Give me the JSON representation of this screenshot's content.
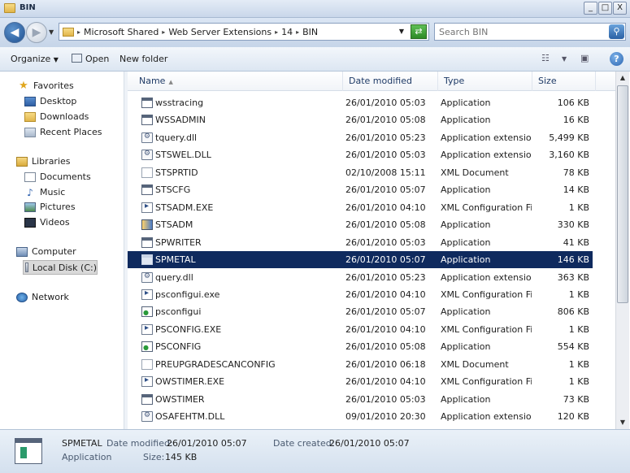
{
  "window": {
    "title": "BIN",
    "controls": [
      "_",
      "□",
      "X"
    ]
  },
  "address": {
    "crumbs": [
      "Microsoft Shared",
      "Web Server Extensions",
      "14",
      "BIN"
    ],
    "search_placeholder": "Search BIN"
  },
  "toolbar": {
    "organize": "Organize",
    "open": "Open",
    "new_folder": "New folder"
  },
  "nav": {
    "favorites": "Favorites",
    "desktop": "Desktop",
    "downloads": "Downloads",
    "recent": "Recent Places",
    "libraries": "Libraries",
    "documents": "Documents",
    "music": "Music",
    "pictures": "Pictures",
    "videos": "Videos",
    "computer": "Computer",
    "local_disk": "Local Disk (C:)",
    "network": "Network"
  },
  "columns": {
    "name": "Name",
    "date": "Date modified",
    "type": "Type",
    "size": "Size"
  },
  "files": [
    {
      "name": "wsstracing",
      "date": "26/01/2010 05:03",
      "type": "Application",
      "size": "106 KB",
      "icon": "app"
    },
    {
      "name": "WSSADMIN",
      "date": "26/01/2010 05:08",
      "type": "Application",
      "size": "16 KB",
      "icon": "app"
    },
    {
      "name": "tquery.dll",
      "date": "26/01/2010 05:23",
      "type": "Application extension",
      "size": "5,499 KB",
      "icon": "dll"
    },
    {
      "name": "STSWEL.DLL",
      "date": "26/01/2010 05:03",
      "type": "Application extension",
      "size": "3,160 KB",
      "icon": "dll"
    },
    {
      "name": "STSPRTID",
      "date": "02/10/2008 15:11",
      "type": "XML Document",
      "size": "78 KB",
      "icon": "xml"
    },
    {
      "name": "STSCFG",
      "date": "26/01/2010 05:07",
      "type": "Application",
      "size": "14 KB",
      "icon": "app"
    },
    {
      "name": "STSADM.EXE",
      "date": "26/01/2010 04:10",
      "type": "XML Configuration File",
      "size": "1 KB",
      "icon": "xmlcfg"
    },
    {
      "name": "STSADM",
      "date": "26/01/2010 05:08",
      "type": "Application",
      "size": "330 KB",
      "icon": "prog"
    },
    {
      "name": "SPWRITER",
      "date": "26/01/2010 05:03",
      "type": "Application",
      "size": "41 KB",
      "icon": "app"
    },
    {
      "name": "SPMETAL",
      "date": "26/01/2010 05:07",
      "type": "Application",
      "size": "146 KB",
      "icon": "app",
      "selected": true
    },
    {
      "name": "query.dll",
      "date": "26/01/2010 05:23",
      "type": "Application extension",
      "size": "363 KB",
      "icon": "dll"
    },
    {
      "name": "psconfigui.exe",
      "date": "26/01/2010 04:10",
      "type": "XML Configuration File",
      "size": "1 KB",
      "icon": "xmlcfg"
    },
    {
      "name": "psconfigui",
      "date": "26/01/2010 05:07",
      "type": "Application",
      "size": "806 KB",
      "icon": "green"
    },
    {
      "name": "PSCONFIG.EXE",
      "date": "26/01/2010 04:10",
      "type": "XML Configuration File",
      "size": "1 KB",
      "icon": "xmlcfg"
    },
    {
      "name": "PSCONFIG",
      "date": "26/01/2010 05:08",
      "type": "Application",
      "size": "554 KB",
      "icon": "green"
    },
    {
      "name": "PREUPGRADESCANCONFIG",
      "date": "26/01/2010 06:18",
      "type": "XML Document",
      "size": "1 KB",
      "icon": "xml"
    },
    {
      "name": "OWSTIMER.EXE",
      "date": "26/01/2010 04:10",
      "type": "XML Configuration File",
      "size": "1 KB",
      "icon": "xmlcfg"
    },
    {
      "name": "OWSTIMER",
      "date": "26/01/2010 05:03",
      "type": "Application",
      "size": "73 KB",
      "icon": "app"
    },
    {
      "name": "OSAFEHTM.DLL",
      "date": "09/01/2010 20:30",
      "type": "Application extension",
      "size": "120 KB",
      "icon": "dll"
    }
  ],
  "details": {
    "name": "SPMETAL",
    "modified_label": "Date modified:",
    "modified": "26/01/2010 05:07",
    "created_label": "Date created:",
    "created": "26/01/2010 05:07",
    "type": "Application",
    "size_label": "Size:",
    "size": "145 KB"
  }
}
